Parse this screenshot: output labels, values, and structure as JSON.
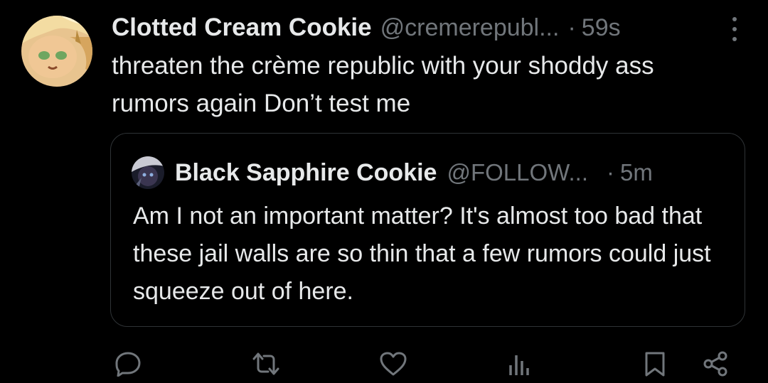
{
  "tweet": {
    "author_name": "Clotted Cream Cookie",
    "author_handle": "@cremerepubl...",
    "separator": "·",
    "time": "59s",
    "text": "threaten the crème republic with your shoddy ass rumors again Don’t test me"
  },
  "quoted_tweet": {
    "author_name": "Black Sapphire Cookie",
    "author_handle": "@FOLLOW...",
    "separator": "·",
    "time": "5m",
    "text": "Am I not an important matter? It's almost too bad that these jail walls are so thin that a few rumors could just squeeze out of here."
  },
  "actions": {
    "icons": [
      "reply-icon",
      "retweet-icon",
      "like-icon",
      "views-icon",
      "bookmark-icon",
      "share-icon"
    ]
  },
  "colors": {
    "background": "#000000",
    "primary_text": "#e7e9ea",
    "secondary_text": "#71767b",
    "border": "#2f3336"
  }
}
